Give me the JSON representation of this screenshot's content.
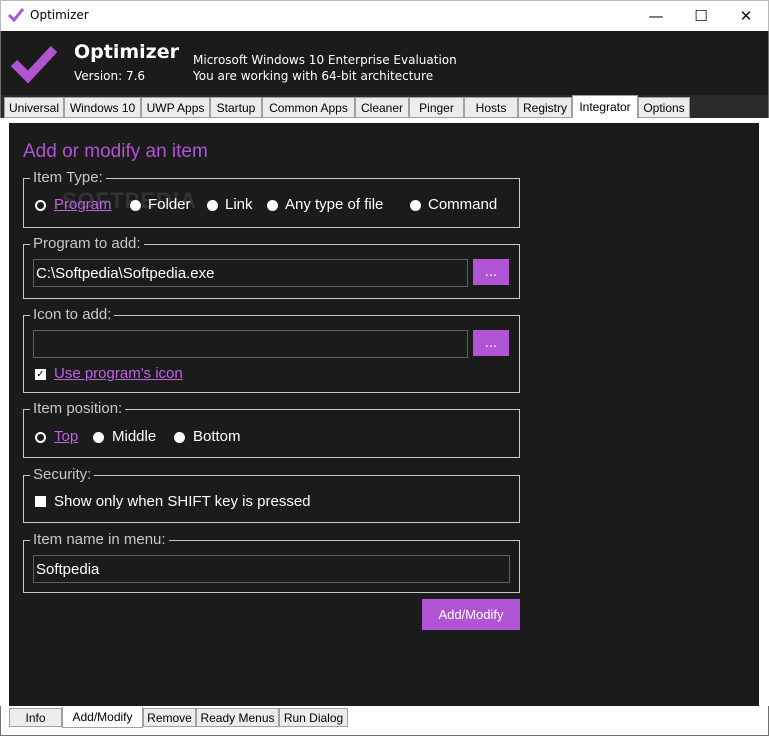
{
  "window": {
    "title": "Optimizer",
    "minimize": "—",
    "maximize": "☐",
    "close": "✕"
  },
  "header": {
    "app_name": "Optimizer",
    "version": "Version: 7.6",
    "os_info": "Microsoft Windows 10 Enterprise Evaluation",
    "arch_info": "You are working with 64-bit architecture"
  },
  "tabs": [
    "Universal",
    "Windows 10",
    "UWP Apps",
    "Startup",
    "Common Apps",
    "Cleaner",
    "Pinger",
    "Hosts",
    "Registry",
    "Integrator",
    "Options"
  ],
  "active_tab": "Integrator",
  "integrator": {
    "heading": "Add or modify an item",
    "item_type": {
      "legend": "Item Type:",
      "options": [
        "Program",
        "Folder",
        "Link",
        "Any type of file",
        "Command"
      ],
      "selected": "Program"
    },
    "program": {
      "legend": "Program to add:",
      "value": "C:\\Softpedia\\Softpedia.exe",
      "browse": "..."
    },
    "icon": {
      "legend": "Icon to add:",
      "value": "",
      "browse": "...",
      "use_program_icon": "Use program's icon",
      "use_program_icon_checked": true
    },
    "position": {
      "legend": "Item position:",
      "options": [
        "Top",
        "Middle",
        "Bottom"
      ],
      "selected": "Top"
    },
    "security": {
      "legend": "Security:",
      "shift_only": "Show only when SHIFT key is pressed",
      "shift_only_checked": false
    },
    "name": {
      "legend": "Item name in menu:",
      "value": "Softpedia"
    },
    "submit": "Add/Modify"
  },
  "watermark": "SOFTPEDIA",
  "bottom_tabs": [
    "Info",
    "Add/Modify",
    "Remove",
    "Ready Menus",
    "Run Dialog"
  ],
  "active_bottom_tab": "Add/Modify",
  "colors": {
    "accent": "#b054d4",
    "link": "#c063e0",
    "panel_bg": "#1b1b1b",
    "header_bg": "#1b1b1b"
  }
}
